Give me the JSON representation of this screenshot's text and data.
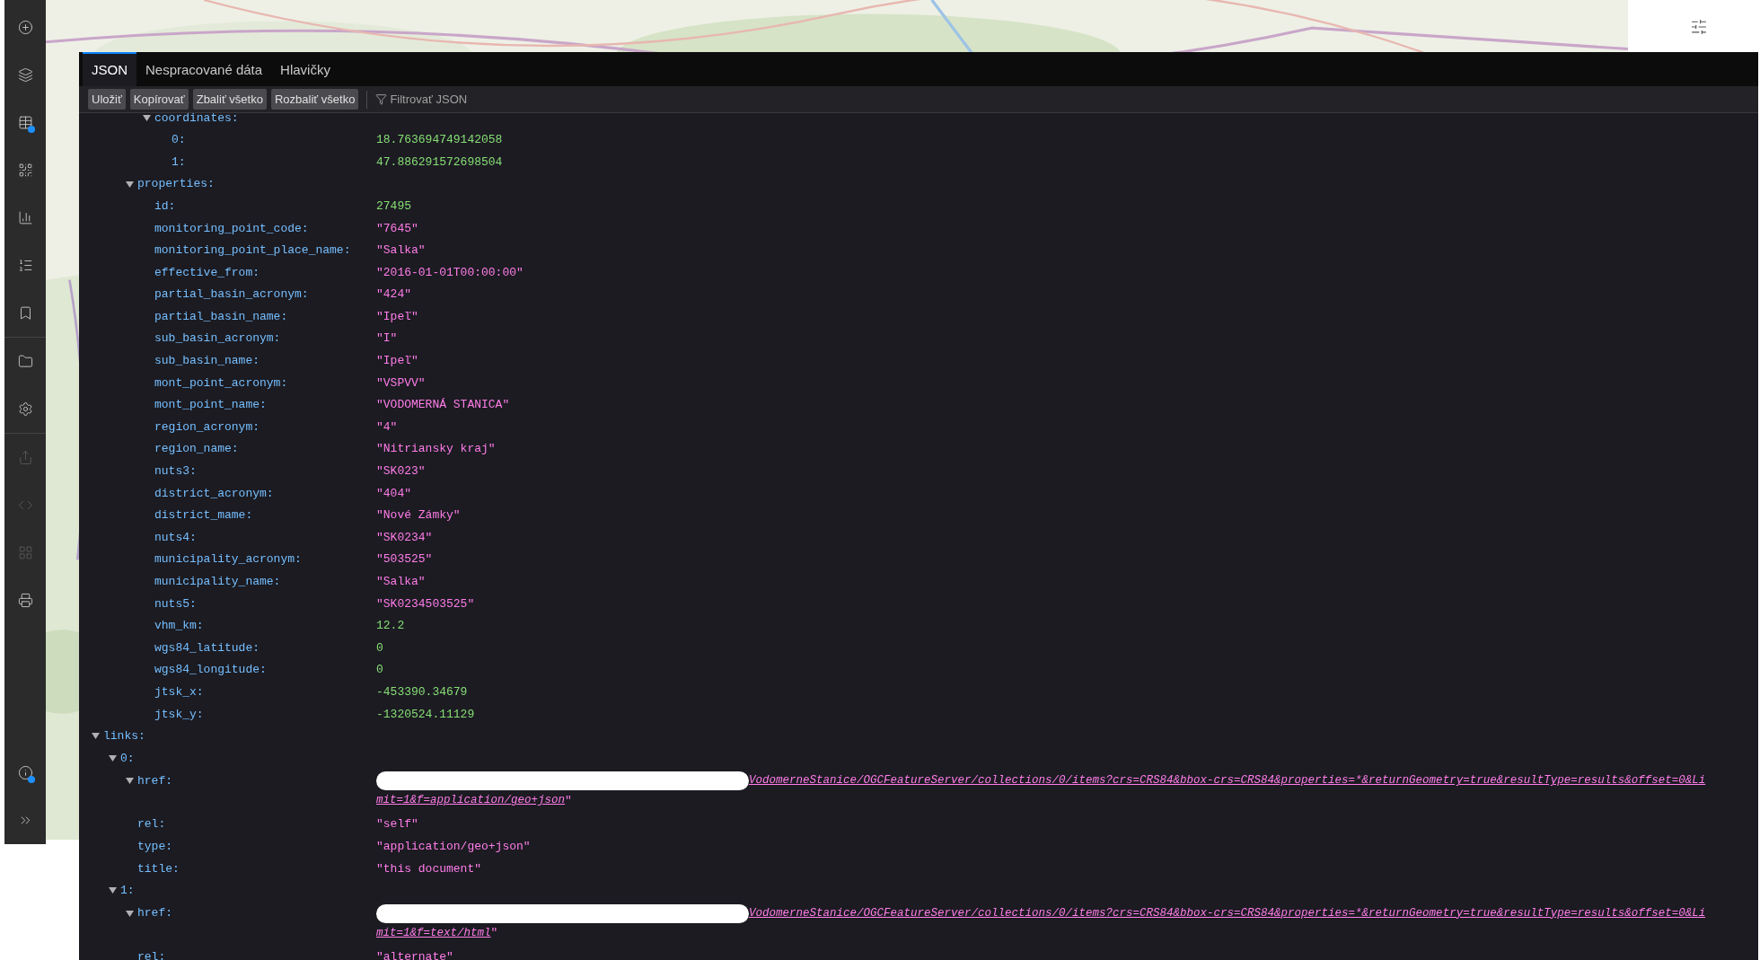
{
  "sidebar": {
    "items": [
      {
        "notification": false,
        "disabled": false
      },
      {
        "notification": false,
        "disabled": false
      },
      {
        "notification": true,
        "disabled": false
      },
      {
        "notification": false,
        "disabled": false
      },
      {
        "notification": false,
        "disabled": false
      },
      {
        "notification": false,
        "disabled": false
      },
      {
        "notification": false,
        "disabled": false
      },
      {
        "notification": false,
        "disabled": false
      },
      {
        "notification": false,
        "disabled": false
      },
      {
        "notification": false,
        "disabled": true
      },
      {
        "notification": false,
        "disabled": true
      },
      {
        "notification": false,
        "disabled": true
      },
      {
        "notification": false,
        "disabled": false
      }
    ],
    "bottom_items": [
      {
        "notification": true
      },
      {
        "notification": false
      }
    ]
  },
  "json_viewer": {
    "tabs": [
      {
        "label": "JSON",
        "selected": true
      },
      {
        "label": "Nespracované dáta",
        "selected": false
      },
      {
        "label": "Hlavičky",
        "selected": false
      }
    ],
    "toolbar": {
      "buttons": [
        "Uložiť",
        "Kopírovať",
        "Zbaliť všetko",
        "Rozbaliť všetko"
      ],
      "filter": {
        "placeholder": "Filtrovať JSON"
      }
    },
    "tree": [
      {
        "children": [
          {
            "children": [
              {
                "children": [
                  {
                    "key": "coordinates:",
                    "expanded": true,
                    "children": [
                      {
                        "key": "0:",
                        "value": "18.763694749142058",
                        "kind": "number"
                      },
                      {
                        "key": "1:",
                        "value": "47.886291572698504",
                        "kind": "number"
                      }
                    ]
                  }
                ]
              },
              {
                "key": "properties:",
                "expanded": true,
                "children": [
                  {
                    "key": "id:",
                    "value": "27495",
                    "kind": "number"
                  },
                  {
                    "key": "monitoring_point_code:",
                    "value": "\"7645\"",
                    "kind": "string"
                  },
                  {
                    "key": "monitoring_point_place_name:",
                    "value": "\"Salka\"",
                    "kind": "string"
                  },
                  {
                    "key": "effective_from:",
                    "value": "\"2016-01-01T00:00:00\"",
                    "kind": "string"
                  },
                  {
                    "key": "partial_basin_acronym:",
                    "value": "\"424\"",
                    "kind": "string"
                  },
                  {
                    "key": "partial_basin_name:",
                    "value": "\"Ipeľ\"",
                    "kind": "string"
                  },
                  {
                    "key": "sub_basin_acronym:",
                    "value": "\"I\"",
                    "kind": "string"
                  },
                  {
                    "key": "sub_basin_name:",
                    "value": "\"Ipeľ\"",
                    "kind": "string"
                  },
                  {
                    "key": "mont_point_acronym:",
                    "value": "\"VSPVV\"",
                    "kind": "string"
                  },
                  {
                    "key": "mont_point_name:",
                    "value": "\"VODOMERNÁ STANICA\"",
                    "kind": "string"
                  },
                  {
                    "key": "region_acronym:",
                    "value": "\"4\"",
                    "kind": "string"
                  },
                  {
                    "key": "region_name:",
                    "value": "\"Nitriansky kraj\"",
                    "kind": "string"
                  },
                  {
                    "key": "nuts3:",
                    "value": "\"SK023\"",
                    "kind": "string"
                  },
                  {
                    "key": "district_acronym:",
                    "value": "\"404\"",
                    "kind": "string"
                  },
                  {
                    "key": "district_mame:",
                    "value": "\"Nové Zámky\"",
                    "kind": "string"
                  },
                  {
                    "key": "nuts4:",
                    "value": "\"SK0234\"",
                    "kind": "string"
                  },
                  {
                    "key": "municipality_acronym:",
                    "value": "\"503525\"",
                    "kind": "string"
                  },
                  {
                    "key": "municipality_name:",
                    "value": "\"Salka\"",
                    "kind": "string"
                  },
                  {
                    "key": "nuts5:",
                    "value": "\"SK0234503525\"",
                    "kind": "string"
                  },
                  {
                    "key": "vhm_km:",
                    "value": "12.2",
                    "kind": "number"
                  },
                  {
                    "key": "wgs84_latitude:",
                    "value": "0",
                    "kind": "number"
                  },
                  {
                    "key": "wgs84_longitude:",
                    "value": "0",
                    "kind": "number"
                  },
                  {
                    "key": "jtsk_x:",
                    "value": "-453390.34679",
                    "kind": "number"
                  },
                  {
                    "key": "jtsk_y:",
                    "value": "-1320524.11129",
                    "kind": "number"
                  }
                ]
              }
            ]
          }
        ]
      },
      {
        "key": "links:",
        "expanded": true,
        "children": [
          {
            "key": "0:",
            "expanded": true,
            "children": [
              {
                "key": "href:",
                "expanded": true,
                "kind": "link",
                "redacted": true,
                "link_lines": [
                  "VodomerneStanice/OGCFeatureServer/collections/0/items?crs=CRS84&bbox-crs=CRS84&properties=*&returnGeometry=true&resultType=results&offset=0&Li",
                  "mit=1&f=application/geo+json"
                ],
                "suffix": "\""
              },
              {
                "key": "rel:",
                "value": "\"self\"",
                "kind": "string"
              },
              {
                "key": "type:",
                "value": "\"application/geo+json\"",
                "kind": "string"
              },
              {
                "key": "title:",
                "value": "\"this document\"",
                "kind": "string"
              }
            ]
          },
          {
            "key": "1:",
            "expanded": true,
            "children": [
              {
                "key": "href:",
                "expanded": true,
                "kind": "link",
                "redacted": true,
                "link_lines": [
                  "VodomerneStanice/OGCFeatureServer/collections/0/items?crs=CRS84&bbox-crs=CRS84&properties=*&returnGeometry=true&resultType=results&offset=0&Li",
                  "mit=1&f=text/html"
                ],
                "suffix": "\""
              },
              {
                "key": "rel:",
                "value": "\"alternate\"",
                "kind": "string"
              }
            ]
          }
        ]
      }
    ]
  }
}
